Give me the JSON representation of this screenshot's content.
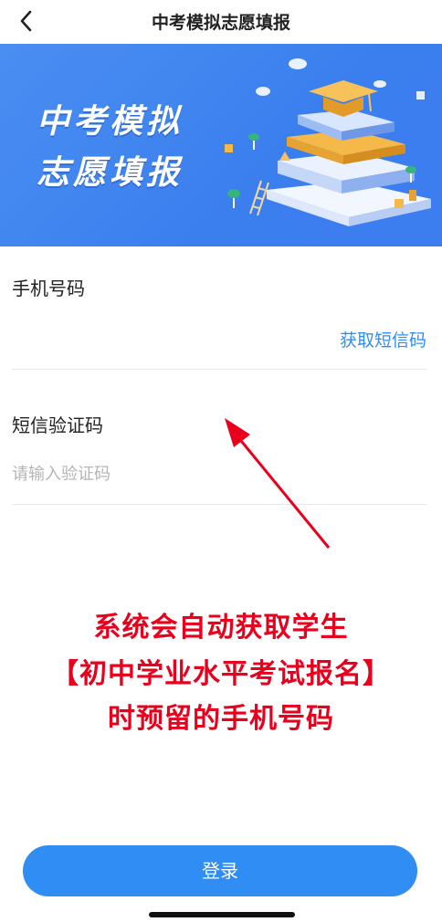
{
  "header": {
    "title": "中考模拟志愿填报"
  },
  "banner": {
    "line1": "中考模拟",
    "line2": "志愿填报"
  },
  "form": {
    "phone_label": "手机号码",
    "sms_button": "获取短信码",
    "code_label": "短信验证码",
    "code_placeholder": "请输入验证码"
  },
  "notice": {
    "line1": "系统会自动获取学生",
    "line2": "【初中学业水平考试报名】",
    "line3": "时预留的手机号码"
  },
  "login_button": "登录",
  "colors": {
    "accent": "#2f8df4",
    "banner": "#3b7fef",
    "notice": "#e8001c"
  },
  "icons": {
    "back": "chevron-left-icon",
    "annotation": "arrow-icon"
  }
}
